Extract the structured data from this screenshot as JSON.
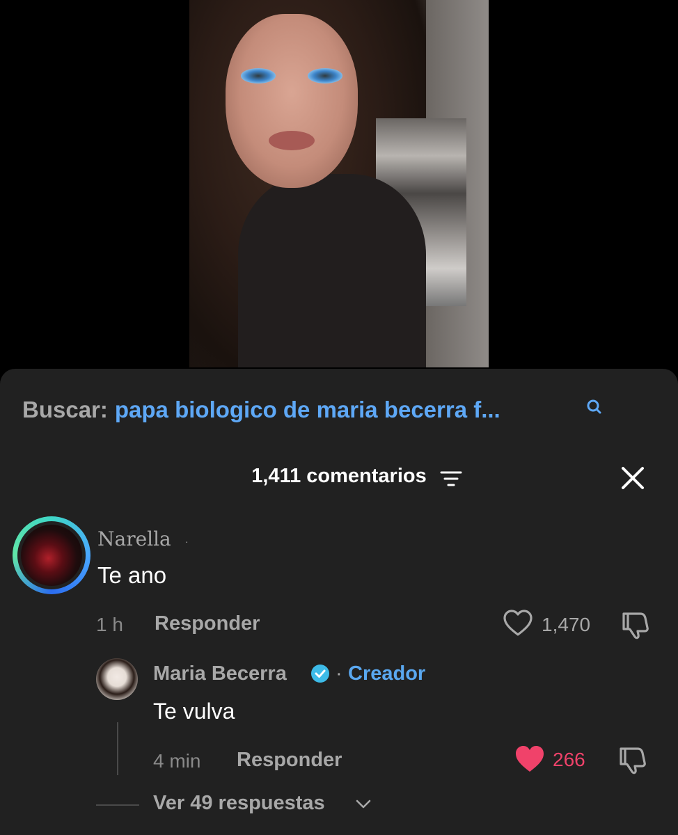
{
  "search": {
    "label": "Buscar:",
    "query": "papa biologico de maria becerra f..."
  },
  "comments_header": {
    "title": "1,411 comentarios"
  },
  "comments": [
    {
      "author": "Narella",
      "author_badge": "·",
      "text": "Te ano",
      "time": "1 h",
      "reply_label": "Responder",
      "likes": "1,470",
      "liked": false
    },
    {
      "author": "Maria Becerra",
      "separator": "·",
      "role": "Creador",
      "text": "Te vulva",
      "time": "4 min",
      "reply_label": "Responder",
      "likes": "266",
      "liked": true
    }
  ],
  "view_replies": "Ver 49 respuestas",
  "colors": {
    "link": "#5ea8f6",
    "like_active": "#f0426a",
    "sheet_bg": "#212121"
  },
  "icons": [
    "search-icon",
    "filter-icon",
    "close-icon",
    "heart-icon",
    "dislike-icon",
    "verified-icon",
    "chevron-down-icon"
  ]
}
